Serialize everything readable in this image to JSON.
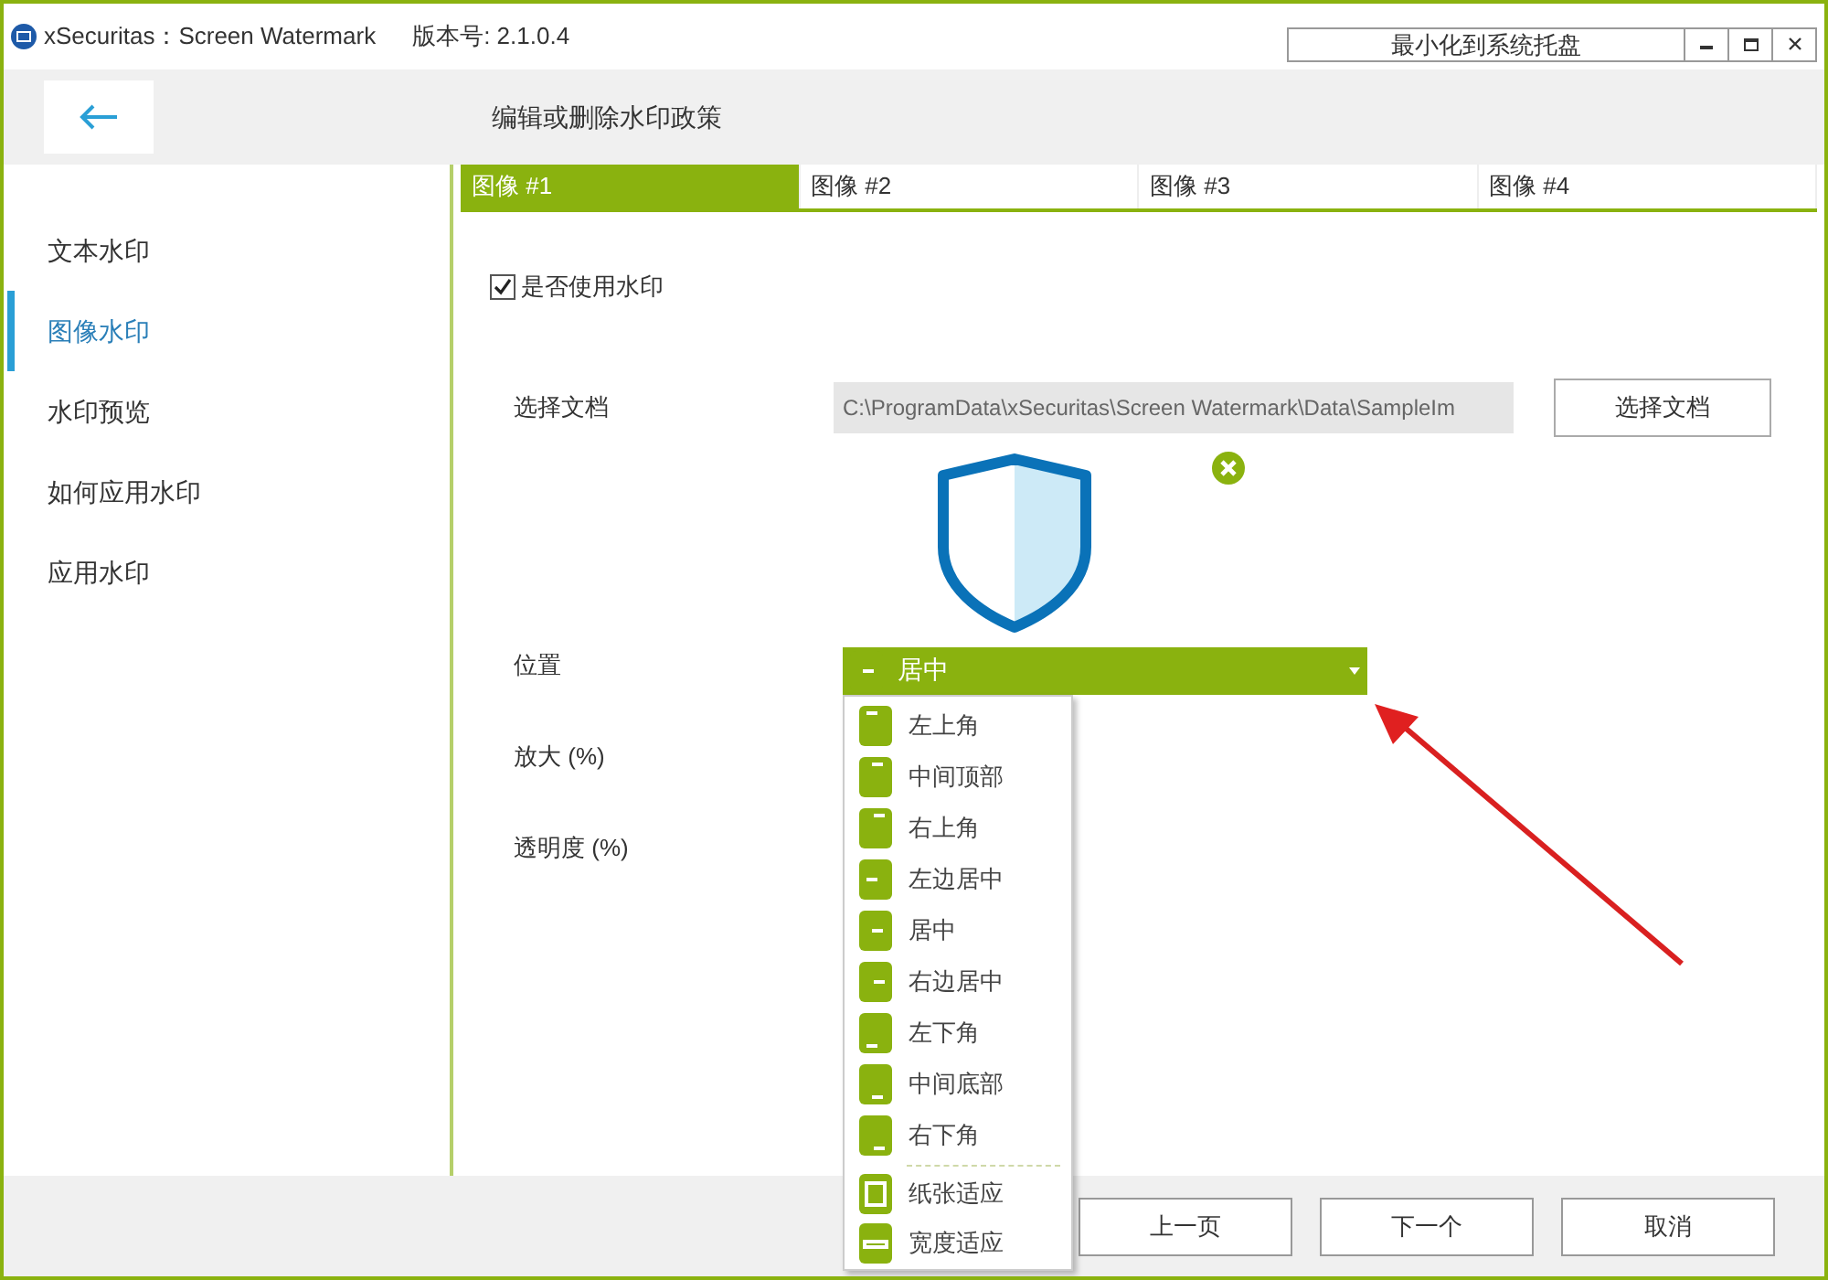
{
  "window": {
    "app_name": "xSecuritas：Screen Watermark",
    "version": "版本号: 2.1.0.4",
    "tray_button": "最小化到系统托盘"
  },
  "header": {
    "title": "编辑或删除水印政策"
  },
  "sidebar": {
    "items": [
      {
        "label": "文本水印",
        "selected": false
      },
      {
        "label": "图像水印",
        "selected": true
      },
      {
        "label": "水印预览",
        "selected": false
      },
      {
        "label": "如何应用水印",
        "selected": false
      },
      {
        "label": "应用水印",
        "selected": false
      }
    ]
  },
  "tabs": [
    {
      "label": "图像 #1",
      "selected": true
    },
    {
      "label": "图像 #2",
      "selected": false
    },
    {
      "label": "图像 #3",
      "selected": false
    },
    {
      "label": "图像 #4",
      "selected": false
    }
  ],
  "form": {
    "use_watermark": {
      "label": "是否使用水印",
      "checked": true
    },
    "file_label": "选择文档",
    "file_path": "C:\\ProgramData\\xSecuritas\\Screen Watermark\\Data\\SampleIm",
    "file_button": "选择文档",
    "position": {
      "label": "位置",
      "value": "居中",
      "kind": "center"
    },
    "scale_label": "放大 (%)",
    "opacity_label": "透明度 (%)"
  },
  "position_menu": [
    {
      "label": "左上角",
      "kind": "top-left"
    },
    {
      "label": "中间顶部",
      "kind": "top-center"
    },
    {
      "label": "右上角",
      "kind": "top-right"
    },
    {
      "label": "左边居中",
      "kind": "middle-left"
    },
    {
      "label": "居中",
      "kind": "center"
    },
    {
      "label": "右边居中",
      "kind": "middle-right"
    },
    {
      "label": "左下角",
      "kind": "bottom-left"
    },
    {
      "label": "中间底部",
      "kind": "bottom-center"
    },
    {
      "label": "右下角",
      "kind": "bottom-right"
    },
    {
      "label": "纸张适应",
      "kind": "fit-page"
    },
    {
      "label": "宽度适应",
      "kind": "fit-width"
    }
  ],
  "footer": {
    "buttons": [
      "上一页",
      "下一个",
      "取消"
    ]
  }
}
